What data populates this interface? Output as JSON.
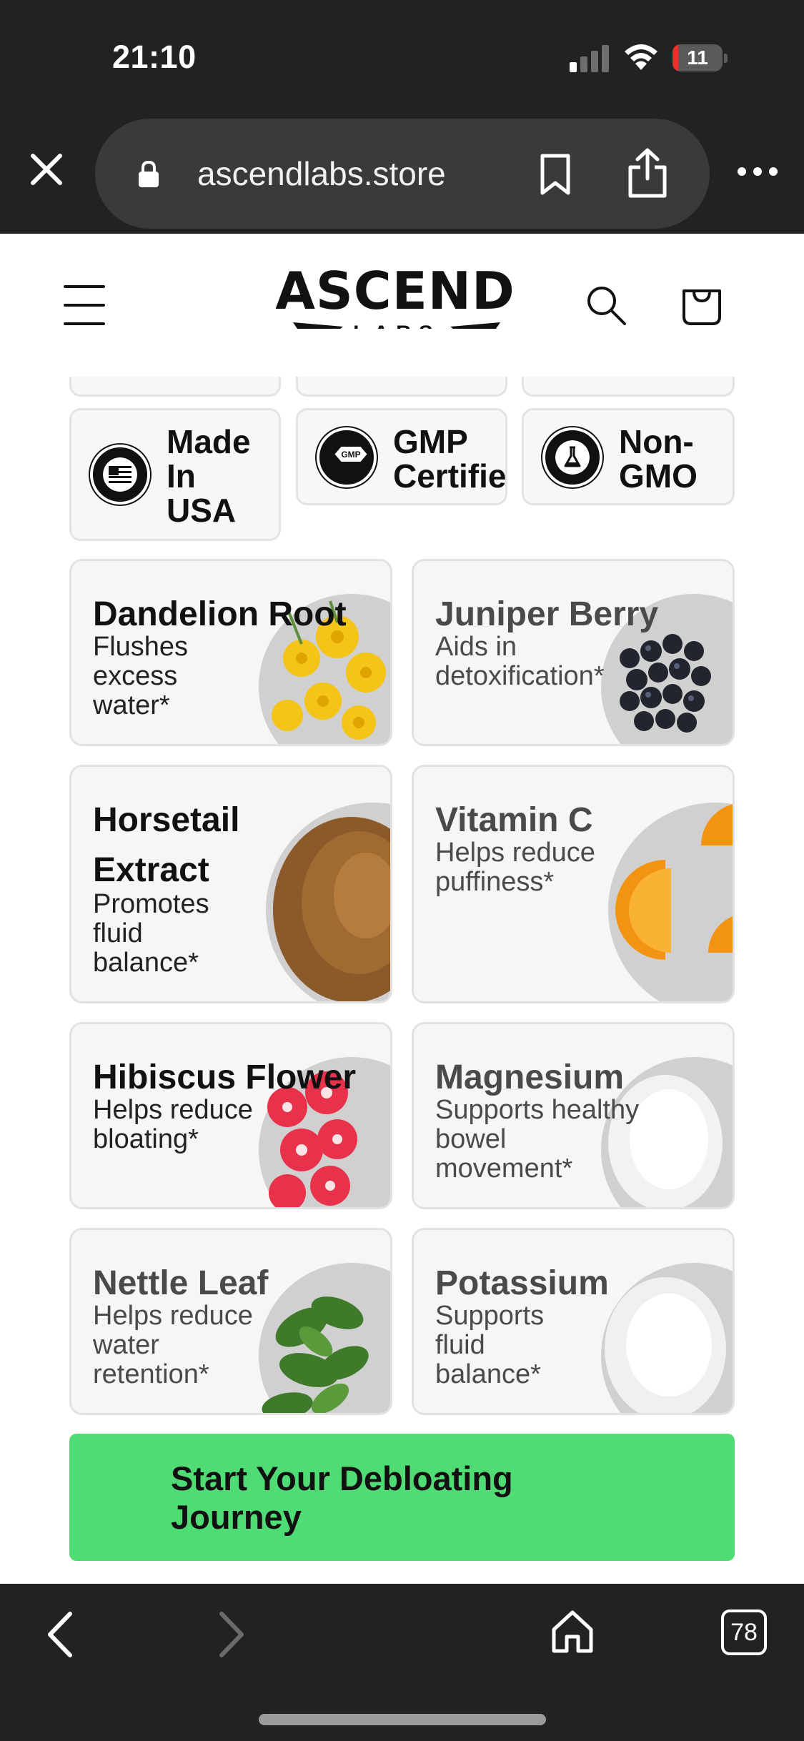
{
  "status_bar": {
    "time": "21:10",
    "battery": "11",
    "battery_fraction": 0.11
  },
  "browser": {
    "url": "ascendlabs.store",
    "tab_count": "78"
  },
  "site": {
    "logo_text": "ASCEND",
    "logo_subtext": "LABS"
  },
  "badges": [
    {
      "label_lines": [
        "Made",
        "In",
        "USA"
      ],
      "seal": "made-in-usa-seal"
    },
    {
      "label_lines": [
        "GMP",
        "Certified"
      ],
      "seal": "gmp-seal"
    },
    {
      "label_lines": [
        "Non-",
        "GMO"
      ],
      "seal": "third-party-tested-seal"
    }
  ],
  "cards": [
    {
      "title": "Dandelion Root",
      "desc": "Flushes excess water*"
    },
    {
      "title": "Juniper Berry",
      "desc": "Aids in detoxification*"
    },
    {
      "title": "Horsetail Extract",
      "desc": "Promotes fluid balance*"
    },
    {
      "title": "Vitamin C",
      "desc": "Helps reduce puffiness*"
    },
    {
      "title": "Hibiscus Flower",
      "desc": "Helps reduce bloating*"
    },
    {
      "title": "Magnesium",
      "desc": "Supports healthy bowel movement*"
    },
    {
      "title": "Nettle Leaf",
      "desc": "Helps reduce water retention*"
    },
    {
      "title": "Potassium",
      "desc": "Supports fluid balance*"
    }
  ],
  "cta": {
    "label": "Start Your Debloating Journey"
  },
  "colors": {
    "cta": "#4fdc74",
    "chrome": "#222223",
    "battery_low": "#e0352b"
  }
}
